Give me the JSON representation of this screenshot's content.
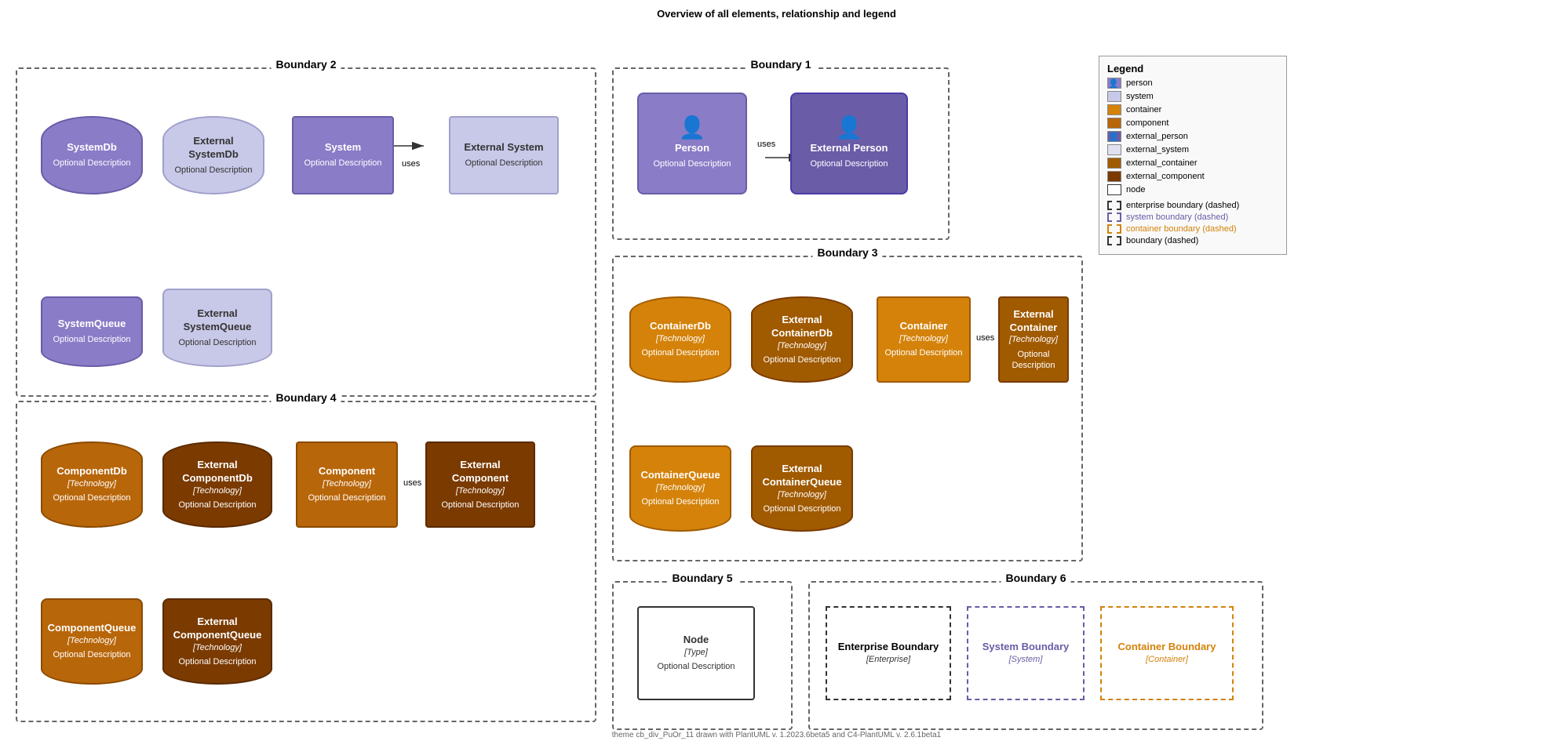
{
  "page": {
    "title": "Overview of all elements, relationship and legend",
    "footer": "theme cb_div_PuOr_11 drawn with PlantUML v. 1.2023.6beta5 and C4-PlantUML v. 2.6.1beta1"
  },
  "boundaries": {
    "b1": {
      "label": "Boundary 1"
    },
    "b2": {
      "label": "Boundary 2"
    },
    "b3": {
      "label": "Boundary 3"
    },
    "b4": {
      "label": "Boundary 4"
    },
    "b5": {
      "label": "Boundary 5"
    },
    "b6": {
      "label": "Boundary 6"
    }
  },
  "elements": {
    "systemDb": {
      "title": "SystemDb",
      "desc": "Optional Description"
    },
    "externalSystemDb": {
      "title": "External SystemDb",
      "desc": "Optional Description"
    },
    "system": {
      "title": "System",
      "desc": "Optional Description"
    },
    "externalSystem": {
      "title": "External System",
      "desc": "Optional Description"
    },
    "systemQueue": {
      "title": "SystemQueue",
      "desc": "Optional Description"
    },
    "externalSystemQueue": {
      "title": "External SystemQueue",
      "desc": "Optional Description"
    },
    "person": {
      "title": "Person",
      "desc": "Optional Description"
    },
    "externalPerson": {
      "title": "External Person",
      "desc": "Optional Description"
    },
    "containerDb": {
      "title": "ContainerDb",
      "tech": "[Technology]",
      "desc": "Optional Description"
    },
    "externalContainerDb": {
      "title": "External ContainerDb",
      "tech": "[Technology]",
      "desc": "Optional Description"
    },
    "container": {
      "title": "Container",
      "tech": "[Technology]",
      "desc": "Optional Description"
    },
    "externalContainer": {
      "title": "External Container",
      "tech": "[Technology]",
      "desc": "Optional Description"
    },
    "containerQueue": {
      "title": "ContainerQueue",
      "tech": "[Technology]",
      "desc": "Optional Description"
    },
    "externalContainerQueue_title": "External ContainerQueue",
    "externalContainerQueue_tech": "[Technology]",
    "externalContainerQueue_desc": "Optional Description",
    "componentDb": {
      "title": "ComponentDb",
      "tech": "[Technology]",
      "desc": "Optional Description"
    },
    "externalComponentDb": {
      "title": "External ComponentDb",
      "tech": "[Technology]",
      "desc": "Optional Description"
    },
    "component": {
      "title": "Component",
      "tech": "[Technology]",
      "desc": "Optional Description"
    },
    "externalComponent": {
      "title": "External Component",
      "tech": "[Technology]",
      "desc": "Optional Description"
    },
    "componentQueue": {
      "title": "ComponentQueue",
      "tech": "[Technology]",
      "desc": "Optional Description"
    },
    "externalComponentQueue_title": "External ComponentQueue",
    "externalComponentQueue_tech": "[Technology]",
    "externalComponentQueue_desc": "Optional Description",
    "node": {
      "title": "Node",
      "tech": "[Type]",
      "desc": "Optional Description"
    },
    "enterpriseBoundary": {
      "title": "Enterprise Boundary",
      "tech": "[Enterprise]"
    },
    "systemBoundary": {
      "title": "System Boundary",
      "tech": "[System]"
    },
    "containerBoundary": {
      "title": "Container Boundary",
      "tech": "[Container]"
    }
  },
  "arrows": {
    "uses": "uses"
  },
  "legend": {
    "title": "Legend",
    "items": [
      {
        "label": "person",
        "color": "#8A7CC7"
      },
      {
        "label": "system",
        "color": "#c8c8e8"
      },
      {
        "label": "container",
        "color": "#d4820a"
      },
      {
        "label": "component",
        "color": "#b8660a"
      },
      {
        "label": "external_person",
        "color": "#6a5ca7"
      },
      {
        "label": "external_system",
        "color": "#e0e0f0"
      },
      {
        "label": "external_container",
        "color": "#a05a00"
      },
      {
        "label": "external_component",
        "color": "#7a3a00"
      },
      {
        "label": "node",
        "color": "#ffffff"
      }
    ],
    "dashed": [
      {
        "label": "enterprise boundary (dashed)",
        "color": "#333",
        "textColor": "#333"
      },
      {
        "label": "system boundary (dashed)",
        "color": "#6a5ca7",
        "textColor": "#6a5ca7"
      },
      {
        "label": "container boundary (dashed)",
        "color": "#d4820a",
        "textColor": "#d4820a"
      },
      {
        "label": "boundary (dashed)",
        "color": "#333",
        "textColor": "#333"
      }
    ]
  }
}
